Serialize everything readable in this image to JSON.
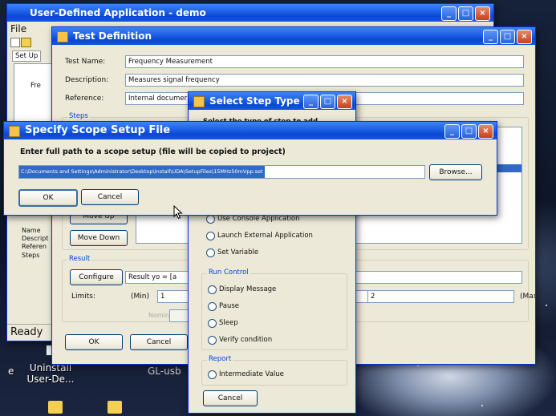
{
  "main_window": {
    "title": "User-Defined Application - demo",
    "menu_file": "File",
    "setup_tab": "Set Up",
    "tree_item": "Fre",
    "side_labels": [
      "Name",
      "Descript",
      "Referen",
      "Steps"
    ],
    "status": "Ready"
  },
  "test_definition": {
    "title": "Test Definition",
    "test_name_label": "Test Name:",
    "test_name_value": "Frequency Measurement",
    "description_label": "Description:",
    "description_value": "Measures signal frequency",
    "reference_label": "Reference:",
    "reference_value": "Internal documer",
    "steps_label": "Steps",
    "move_up": "Move Up",
    "move_down": "Move Down",
    "result_label": "Result",
    "configure": "Configure",
    "result_value": "Result  yo = [a",
    "limits_label": "Limits:",
    "min_label": "(Min)",
    "min_value": "1",
    "max_value": "2",
    "max_label": "(Max)",
    "nominal_label": "Nominal",
    "ok": "OK",
    "cancel": "Cancel"
  },
  "select_step_type": {
    "title": "Select Step Type",
    "prompt": "Select the type of step to add",
    "options_top": [
      "Use Console Application",
      "Launch External Application",
      "Set Variable"
    ],
    "run_control_label": "Run Control",
    "run_control_options": [
      "Display Message",
      "Pause",
      "Sleep",
      "Verify condition"
    ],
    "report_label": "Report",
    "report_options": [
      "Intermediate Value"
    ],
    "cancel": "Cancel"
  },
  "scope_setup": {
    "title": "Specify Scope Setup File",
    "prompt": "Enter full path to a scope setup (file will be copied to project)",
    "path_value": "C:\\Documents and Settings\\Administrator\\Desktop\\Install\\UDA\\SetupFiles\\15MHz50mVpp.set",
    "browse": "Browse...",
    "ok": "OK",
    "cancel": "Cancel"
  },
  "desktop_icons": {
    "uninstall_line1": "Uninstall",
    "uninstall_line2": "User-De...",
    "gl_usb": "GL-usb",
    "left_partial": "e"
  }
}
